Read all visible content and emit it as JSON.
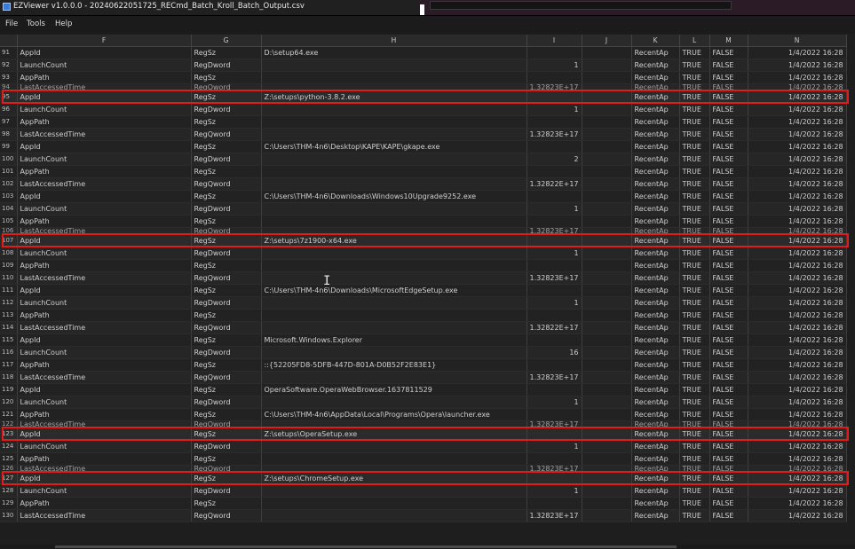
{
  "window": {
    "title": "EZViewer v1.0.0.0 - 20240622051725_RECmd_Batch_Kroll_Batch_Output.csv"
  },
  "menu": [
    "File",
    "Tools",
    "Help"
  ],
  "columns": [
    "",
    "F",
    "G",
    "H",
    "I",
    "J",
    "K",
    "L",
    "M",
    "N"
  ],
  "rows": [
    {
      "n": "91",
      "f": "AppId",
      "g": "RegSz",
      "h": "D:\\setup64.exe",
      "hv": "",
      "k": "RecentAp",
      "l": "TRUE",
      "m": "FALSE",
      "d": "1/4/2022 16:28"
    },
    {
      "n": "92",
      "f": "LaunchCount",
      "g": "RegDword",
      "h": "",
      "hv": "1",
      "k": "RecentAp",
      "l": "TRUE",
      "m": "FALSE",
      "d": "1/4/2022 16:28"
    },
    {
      "n": "93",
      "f": "AppPath",
      "g": "RegSz",
      "h": "",
      "hv": "",
      "k": "RecentAp",
      "l": "TRUE",
      "m": "FALSE",
      "d": "1/4/2022 16:28"
    },
    {
      "n": "94",
      "f": "LastAccessedTime",
      "g": "RegQword",
      "h": "",
      "hv": "1.32823E+17",
      "k": "RecentAp",
      "l": "TRUE",
      "m": "FALSE",
      "d": "1/4/2022 16:28",
      "clip": true
    },
    {
      "n": "95",
      "f": "AppId",
      "g": "RegSz",
      "h": "Z:\\setups\\python-3.8.2.exe",
      "hv": "",
      "k": "RecentAp",
      "l": "TRUE",
      "m": "FALSE",
      "d": "1/4/2022 16:28",
      "hl": true
    },
    {
      "n": "96",
      "f": "LaunchCount",
      "g": "RegDword",
      "h": "",
      "hv": "1",
      "k": "RecentAp",
      "l": "TRUE",
      "m": "FALSE",
      "d": "1/4/2022 16:28"
    },
    {
      "n": "97",
      "f": "AppPath",
      "g": "RegSz",
      "h": "",
      "hv": "",
      "k": "RecentAp",
      "l": "TRUE",
      "m": "FALSE",
      "d": "1/4/2022 16:28"
    },
    {
      "n": "98",
      "f": "LastAccessedTime",
      "g": "RegQword",
      "h": "",
      "hv": "1.32823E+17",
      "k": "RecentAp",
      "l": "TRUE",
      "m": "FALSE",
      "d": "1/4/2022 16:28"
    },
    {
      "n": "99",
      "f": "AppId",
      "g": "RegSz",
      "h": "C:\\Users\\THM-4n6\\Desktop\\KAPE\\KAPE\\gkape.exe",
      "hv": "",
      "k": "RecentAp",
      "l": "TRUE",
      "m": "FALSE",
      "d": "1/4/2022 16:28"
    },
    {
      "n": "100",
      "f": "LaunchCount",
      "g": "RegDword",
      "h": "",
      "hv": "2",
      "k": "RecentAp",
      "l": "TRUE",
      "m": "FALSE",
      "d": "1/4/2022 16:28"
    },
    {
      "n": "101",
      "f": "AppPath",
      "g": "RegSz",
      "h": "",
      "hv": "",
      "k": "RecentAp",
      "l": "TRUE",
      "m": "FALSE",
      "d": "1/4/2022 16:28"
    },
    {
      "n": "102",
      "f": "LastAccessedTime",
      "g": "RegQword",
      "h": "",
      "hv": "1.32822E+17",
      "k": "RecentAp",
      "l": "TRUE",
      "m": "FALSE",
      "d": "1/4/2022 16:28"
    },
    {
      "n": "103",
      "f": "AppId",
      "g": "RegSz",
      "h": "C:\\Users\\THM-4n6\\Downloads\\Windows10Upgrade9252.exe",
      "hv": "",
      "k": "RecentAp",
      "l": "TRUE",
      "m": "FALSE",
      "d": "1/4/2022 16:28"
    },
    {
      "n": "104",
      "f": "LaunchCount",
      "g": "RegDword",
      "h": "",
      "hv": "1",
      "k": "RecentAp",
      "l": "TRUE",
      "m": "FALSE",
      "d": "1/4/2022 16:28"
    },
    {
      "n": "105",
      "f": "AppPath",
      "g": "RegSz",
      "h": "",
      "hv": "",
      "k": "RecentAp",
      "l": "TRUE",
      "m": "FALSE",
      "d": "1/4/2022 16:28"
    },
    {
      "n": "106",
      "f": "LastAccessedTime",
      "g": "RegQword",
      "h": "",
      "hv": "1.32823E+17",
      "k": "RecentAp",
      "l": "TRUE",
      "m": "FALSE",
      "d": "1/4/2022 16:28",
      "clip": true
    },
    {
      "n": "107",
      "f": "AppId",
      "g": "RegSz",
      "h": "Z:\\setups\\7z1900-x64.exe",
      "hv": "",
      "k": "RecentAp",
      "l": "TRUE",
      "m": "FALSE",
      "d": "1/4/2022 16:28",
      "hl": true
    },
    {
      "n": "108",
      "f": "LaunchCount",
      "g": "RegDword",
      "h": "",
      "hv": "1",
      "k": "RecentAp",
      "l": "TRUE",
      "m": "FALSE",
      "d": "1/4/2022 16:28"
    },
    {
      "n": "109",
      "f": "AppPath",
      "g": "RegSz",
      "h": "",
      "hv": "",
      "k": "RecentAp",
      "l": "TRUE",
      "m": "FALSE",
      "d": "1/4/2022 16:28"
    },
    {
      "n": "110",
      "f": "LastAccessedTime",
      "g": "RegQword",
      "h": "",
      "hv": "1.32823E+17",
      "k": "RecentAp",
      "l": "TRUE",
      "m": "FALSE",
      "d": "1/4/2022 16:28"
    },
    {
      "n": "111",
      "f": "AppId",
      "g": "RegSz",
      "h": "C:\\Users\\THM-4n6\\Downloads\\MicrosoftEdgeSetup.exe",
      "hv": "",
      "k": "RecentAp",
      "l": "TRUE",
      "m": "FALSE",
      "d": "1/4/2022 16:28"
    },
    {
      "n": "112",
      "f": "LaunchCount",
      "g": "RegDword",
      "h": "",
      "hv": "1",
      "k": "RecentAp",
      "l": "TRUE",
      "m": "FALSE",
      "d": "1/4/2022 16:28"
    },
    {
      "n": "113",
      "f": "AppPath",
      "g": "RegSz",
      "h": "",
      "hv": "",
      "k": "RecentAp",
      "l": "TRUE",
      "m": "FALSE",
      "d": "1/4/2022 16:28"
    },
    {
      "n": "114",
      "f": "LastAccessedTime",
      "g": "RegQword",
      "h": "",
      "hv": "1.32822E+17",
      "k": "RecentAp",
      "l": "TRUE",
      "m": "FALSE",
      "d": "1/4/2022 16:28"
    },
    {
      "n": "115",
      "f": "AppId",
      "g": "RegSz",
      "h": "Microsoft.Windows.Explorer",
      "hv": "",
      "k": "RecentAp",
      "l": "TRUE",
      "m": "FALSE",
      "d": "1/4/2022 16:28"
    },
    {
      "n": "116",
      "f": "LaunchCount",
      "g": "RegDword",
      "h": "",
      "hv": "16",
      "k": "RecentAp",
      "l": "TRUE",
      "m": "FALSE",
      "d": "1/4/2022 16:28"
    },
    {
      "n": "117",
      "f": "AppPath",
      "g": "RegSz",
      "h": "::{52205FD8-5DFB-447D-801A-D0B52F2E83E1}",
      "hv": "",
      "k": "RecentAp",
      "l": "TRUE",
      "m": "FALSE",
      "d": "1/4/2022 16:28"
    },
    {
      "n": "118",
      "f": "LastAccessedTime",
      "g": "RegQword",
      "h": "",
      "hv": "1.32823E+17",
      "k": "RecentAp",
      "l": "TRUE",
      "m": "FALSE",
      "d": "1/4/2022 16:28"
    },
    {
      "n": "119",
      "f": "AppId",
      "g": "RegSz",
      "h": "OperaSoftware.OperaWebBrowser.1637811529",
      "hv": "",
      "k": "RecentAp",
      "l": "TRUE",
      "m": "FALSE",
      "d": "1/4/2022 16:28"
    },
    {
      "n": "120",
      "f": "LaunchCount",
      "g": "RegDword",
      "h": "",
      "hv": "1",
      "k": "RecentAp",
      "l": "TRUE",
      "m": "FALSE",
      "d": "1/4/2022 16:28"
    },
    {
      "n": "121",
      "f": "AppPath",
      "g": "RegSz",
      "h": "C:\\Users\\THM-4n6\\AppData\\Local\\Programs\\Opera\\launcher.exe",
      "hv": "",
      "k": "RecentAp",
      "l": "TRUE",
      "m": "FALSE",
      "d": "1/4/2022 16:28"
    },
    {
      "n": "122",
      "f": "LastAccessedTime",
      "g": "RegQword",
      "h": "",
      "hv": "1.32823E+17",
      "k": "RecentAp",
      "l": "TRUE",
      "m": "FALSE",
      "d": "1/4/2022 16:28",
      "clip": true
    },
    {
      "n": "123",
      "f": "AppId",
      "g": "RegSz",
      "h": "Z:\\setups\\OperaSetup.exe",
      "hv": "",
      "k": "RecentAp",
      "l": "TRUE",
      "m": "FALSE",
      "d": "1/4/2022 16:28",
      "hl": true
    },
    {
      "n": "124",
      "f": "LaunchCount",
      "g": "RegDword",
      "h": "",
      "hv": "1",
      "k": "RecentAp",
      "l": "TRUE",
      "m": "FALSE",
      "d": "1/4/2022 16:28"
    },
    {
      "n": "125",
      "f": "AppPath",
      "g": "RegSz",
      "h": "",
      "hv": "",
      "k": "RecentAp",
      "l": "TRUE",
      "m": "FALSE",
      "d": "1/4/2022 16:28"
    },
    {
      "n": "126",
      "f": "LastAccessedTime",
      "g": "RegQword",
      "h": "",
      "hv": "1.32823E+17",
      "k": "RecentAp",
      "l": "TRUE",
      "m": "FALSE",
      "d": "1/4/2022 16:28",
      "clip": true
    },
    {
      "n": "127",
      "f": "AppId",
      "g": "RegSz",
      "h": "Z:\\setups\\ChromeSetup.exe",
      "hv": "",
      "k": "RecentAp",
      "l": "TRUE",
      "m": "FALSE",
      "d": "1/4/2022 16:28",
      "hl": true
    },
    {
      "n": "128",
      "f": "LaunchCount",
      "g": "RegDword",
      "h": "",
      "hv": "1",
      "k": "RecentAp",
      "l": "TRUE",
      "m": "FALSE",
      "d": "1/4/2022 16:28"
    },
    {
      "n": "129",
      "f": "AppPath",
      "g": "RegSz",
      "h": "",
      "hv": "",
      "k": "RecentAp",
      "l": "TRUE",
      "m": "FALSE",
      "d": "1/4/2022 16:28"
    },
    {
      "n": "130",
      "f": "LastAccessedTime",
      "g": "RegQword",
      "h": "",
      "hv": "1.32823E+17",
      "k": "RecentAp",
      "l": "TRUE",
      "m": "FALSE",
      "d": "1/4/2022 16:28"
    }
  ],
  "colors": {
    "highlight_box": "#e21b1b",
    "accent": "#3a7bd5"
  },
  "icons": {
    "app": "app-icon",
    "cursor": "text-cursor-icon"
  }
}
